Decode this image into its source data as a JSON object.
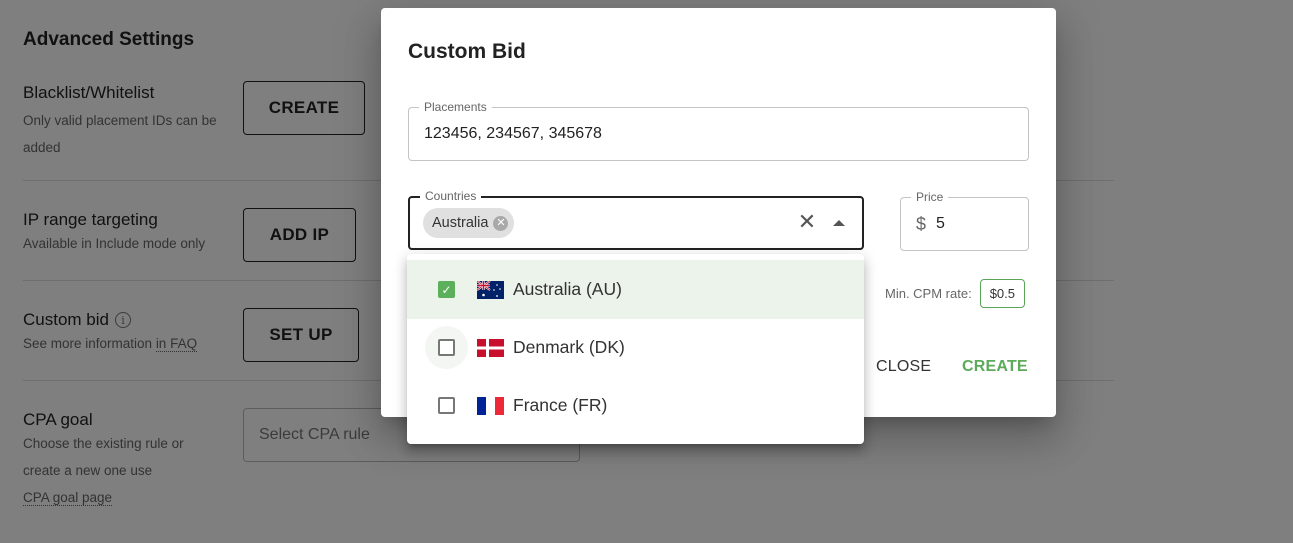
{
  "page": {
    "section_title": "Advanced Settings",
    "rows": [
      {
        "title": "Blacklist/Whitelist",
        "description": "Only valid placement IDs can be added",
        "button": "CREATE"
      },
      {
        "title": "IP range targeting",
        "description": "Available in Include mode only",
        "button": "ADD IP"
      },
      {
        "title": "Custom bid",
        "description_prefix": "See more information ",
        "description_link": "in FAQ",
        "button": "SET UP",
        "icon": "info-icon"
      },
      {
        "title": "CPA goal",
        "description_lines": [
          "Choose the existing rule or",
          "create a new one use"
        ],
        "description_link": "CPA goal page",
        "select_placeholder": "Select CPA rule"
      }
    ]
  },
  "modal": {
    "title": "Custom Bid",
    "placements": {
      "label": "Placements",
      "value": "123456, 234567, 345678"
    },
    "countries": {
      "label": "Countries",
      "chips": [
        "Australia"
      ],
      "clear_icon": "close-icon",
      "toggle_icon": "arrow-up-icon",
      "options": [
        {
          "label": "Australia (AU)",
          "code": "AU",
          "checked": true
        },
        {
          "label": "Denmark (DK)",
          "code": "DK",
          "checked": false
        },
        {
          "label": "France (FR)",
          "code": "FR",
          "checked": false
        }
      ]
    },
    "price": {
      "label": "Price",
      "currency": "$",
      "value": "5"
    },
    "min_cpm": {
      "label": "Min. CPM rate:",
      "value": "$0.5"
    },
    "actions": {
      "close": "CLOSE",
      "create": "CREATE"
    }
  },
  "colors": {
    "accent_green": "#5bab5b",
    "selected_row": "#ebf3ea",
    "overlay": "rgba(0,0,0,0.5)"
  }
}
